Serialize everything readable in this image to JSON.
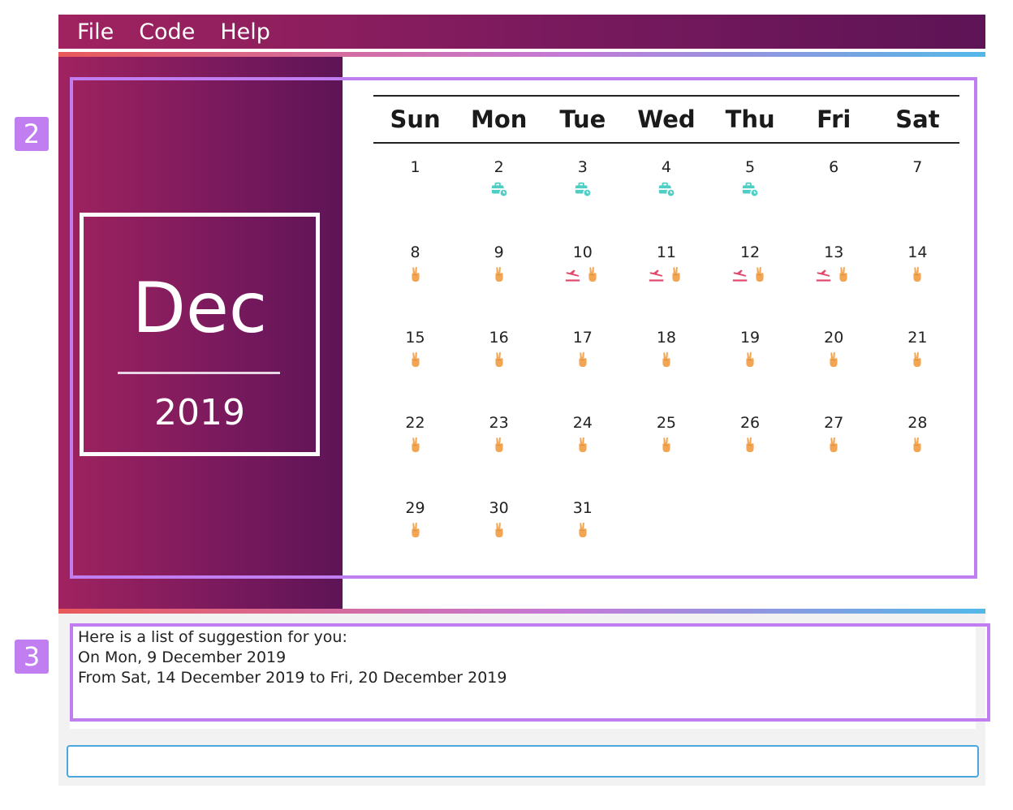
{
  "menu": {
    "items": [
      "File",
      "Code",
      "Help"
    ]
  },
  "month_panel": {
    "month": "Dec",
    "year": "2019"
  },
  "calendar": {
    "weekdays": [
      "Sun",
      "Mon",
      "Tue",
      "Wed",
      "Thu",
      "Fri",
      "Sat"
    ],
    "days": [
      {
        "n": "1",
        "icons": []
      },
      {
        "n": "2",
        "icons": [
          "work"
        ]
      },
      {
        "n": "3",
        "icons": [
          "work"
        ]
      },
      {
        "n": "4",
        "icons": [
          "work"
        ]
      },
      {
        "n": "5",
        "icons": [
          "work"
        ]
      },
      {
        "n": "6",
        "icons": []
      },
      {
        "n": "7",
        "icons": []
      },
      {
        "n": "8",
        "icons": [
          "peace"
        ]
      },
      {
        "n": "9",
        "icons": [
          "peace"
        ]
      },
      {
        "n": "10",
        "icons": [
          "flight",
          "peace"
        ]
      },
      {
        "n": "11",
        "icons": [
          "flight",
          "peace"
        ]
      },
      {
        "n": "12",
        "icons": [
          "flight",
          "peace"
        ]
      },
      {
        "n": "13",
        "icons": [
          "flight",
          "peace"
        ]
      },
      {
        "n": "14",
        "icons": [
          "peace"
        ]
      },
      {
        "n": "15",
        "icons": [
          "peace"
        ]
      },
      {
        "n": "16",
        "icons": [
          "peace"
        ]
      },
      {
        "n": "17",
        "icons": [
          "peace"
        ]
      },
      {
        "n": "18",
        "icons": [
          "peace"
        ]
      },
      {
        "n": "19",
        "icons": [
          "peace"
        ]
      },
      {
        "n": "20",
        "icons": [
          "peace"
        ]
      },
      {
        "n": "21",
        "icons": [
          "peace"
        ]
      },
      {
        "n": "22",
        "icons": [
          "peace"
        ]
      },
      {
        "n": "23",
        "icons": [
          "peace"
        ]
      },
      {
        "n": "24",
        "icons": [
          "peace"
        ]
      },
      {
        "n": "25",
        "icons": [
          "peace"
        ]
      },
      {
        "n": "26",
        "icons": [
          "peace"
        ]
      },
      {
        "n": "27",
        "icons": [
          "peace"
        ]
      },
      {
        "n": "28",
        "icons": [
          "peace"
        ]
      },
      {
        "n": "29",
        "icons": [
          "peace"
        ]
      },
      {
        "n": "30",
        "icons": [
          "peace"
        ]
      },
      {
        "n": "31",
        "icons": [
          "peace"
        ]
      }
    ],
    "icon_colors": {
      "work": "#4fcfc4",
      "flight": "#e2476c",
      "peace": "#f2a552"
    }
  },
  "badges": {
    "calendar": "2",
    "result": "3"
  },
  "result": {
    "lines": [
      "Here is a list of suggestion for you:",
      "On Mon, 9 December 2019",
      "From Sat, 14 December 2019 to Fri, 20 December 2019"
    ]
  },
  "command_box": {
    "value": ""
  },
  "colors": {
    "highlight": "#c07ef0",
    "header_start": "#a0235f",
    "header_end": "#5d1456"
  }
}
